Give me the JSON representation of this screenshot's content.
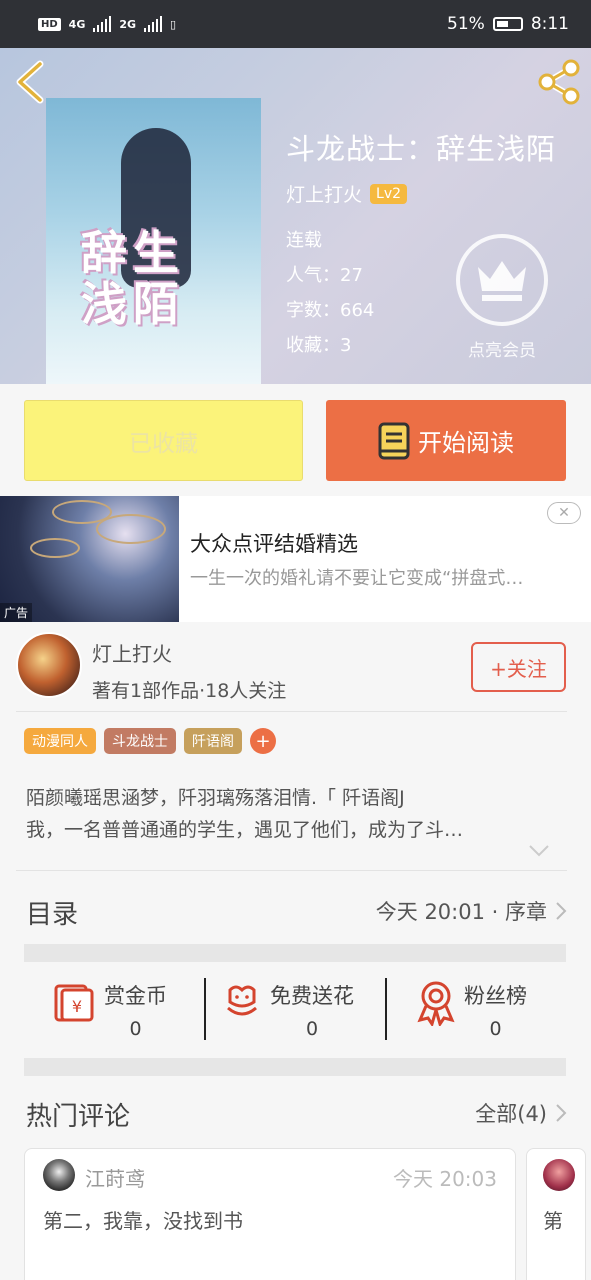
{
  "status_bar": {
    "hd": "HD",
    "net1": "4G",
    "net2": "2G",
    "battery_pct": "51%",
    "time": "8:11"
  },
  "header": {
    "back_icon": "chevron-left-icon",
    "share_icon": "share-icon"
  },
  "book": {
    "cover_title": "辞生浅陌",
    "title": "斗龙战士：辞生浅陌",
    "author": "灯上打火",
    "level": "Lv2",
    "status": "连载",
    "popularity": "人气：27",
    "word_count": "字数：664",
    "favorites": "收藏：3"
  },
  "vip": {
    "label": "点亮会员",
    "icon": "crown-icon"
  },
  "actions": {
    "collected_label": "已收藏",
    "read_label": "开始阅读",
    "read_icon": "book-icon"
  },
  "ad": {
    "title": "大众点评结婚精选",
    "subtitle": "一生一次的婚礼请不要让它变成“拼盘式…",
    "tag": "广告",
    "close": "✕"
  },
  "author_info": {
    "name": "灯上打火",
    "stats": "著有1部作品·18人关注",
    "follow_label": "+关注"
  },
  "tags": [
    {
      "label": "动漫同人",
      "color": "#f5a93e"
    },
    {
      "label": "斗龙战士",
      "color": "#c27b63"
    },
    {
      "label": "阡语阁",
      "color": "#c6a05c"
    },
    {
      "label": "+",
      "color": "#ec6f45"
    }
  ],
  "intro": {
    "line1": "陌颜曦瑶思涵梦，阡羽璃殇落泪情.「 阡语阁J",
    "line2": "我，一名普普通通的学生，遇见了他们，成为了斗…"
  },
  "toc": {
    "title": "目录",
    "latest": "今天 20:01 · 序章"
  },
  "rewards": [
    {
      "label": "赏金币",
      "count": "0",
      "icon": "red-envelope-icon"
    },
    {
      "label": "免费送花",
      "count": "0",
      "icon": "flower-icon"
    },
    {
      "label": "粉丝榜",
      "count": "0",
      "icon": "medal-icon"
    }
  ],
  "comments": {
    "title": "热门评论",
    "all_label": "全部(4)",
    "items": [
      {
        "user": "江莳鸢",
        "time": "今天 20:03",
        "text": "第二，我靠，没找到书"
      },
      {
        "text": "第"
      }
    ]
  },
  "colors": {
    "accent": "#ec6f45",
    "collected_bg": "#fbf37a",
    "follow": "#e35e4c",
    "icon_red": "#d4442e"
  }
}
